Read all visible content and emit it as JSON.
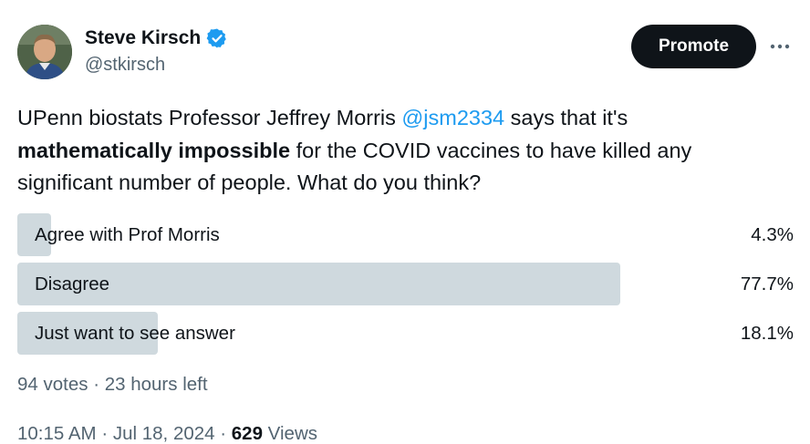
{
  "author": {
    "name": "Steve Kirsch",
    "handle": "@stkirsch"
  },
  "actions": {
    "promote_label": "Promote",
    "more_label": "···"
  },
  "tweet": {
    "line1_prefix": "UPenn biostats Professor Jeffrey Morris ",
    "mention": "@jsm2334",
    "line1_suffix": " says that it's",
    "bold": "mathematically impossible",
    "line2_suffix": " for the COVID vaccines to have killed any",
    "line3": "significant number of people. What do you think?"
  },
  "poll": {
    "options": [
      {
        "label": "Agree with Prof Morris",
        "percent_text": "4.3%",
        "percent": 4.3
      },
      {
        "label": "Disagree",
        "percent_text": "77.7%",
        "percent": 77.7
      },
      {
        "label": "Just want to see answer",
        "percent_text": "18.1%",
        "percent": 18.1
      }
    ],
    "bar_color": "#cfd9de",
    "votes": "94 votes",
    "separator": " · ",
    "time_left": "23 hours left"
  },
  "meta": {
    "time": "10:15 AM",
    "date": "Jul 18, 2024",
    "separator": " · ",
    "views_count": "629",
    "views_label": " Views"
  },
  "colors": {
    "text": "#0f1419",
    "secondary": "#536471",
    "link": "#1d9bf0",
    "verified": "#1d9bf0"
  }
}
